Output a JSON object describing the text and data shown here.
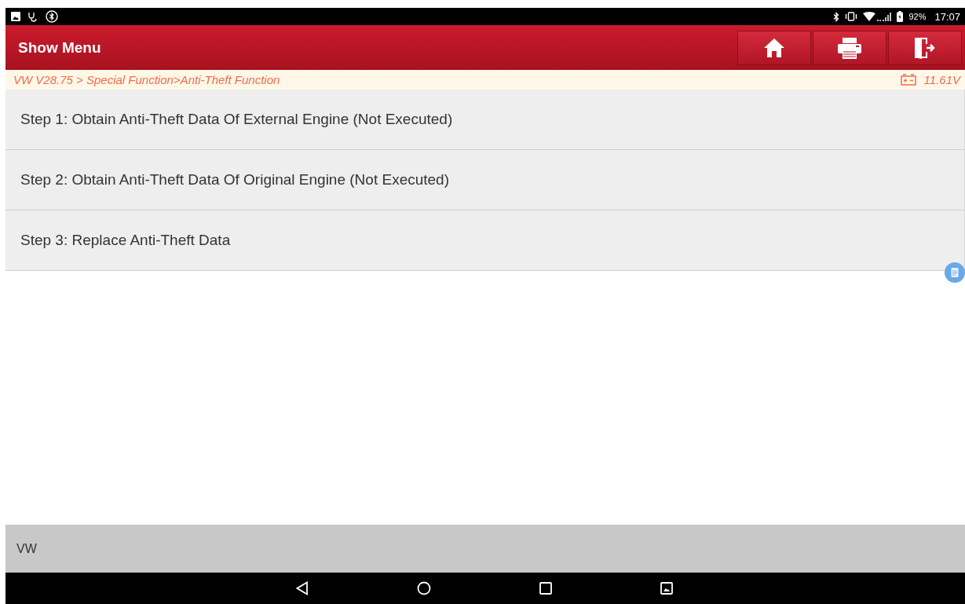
{
  "status_bar": {
    "battery": "92%",
    "time": "17:07"
  },
  "header": {
    "title": "Show Menu"
  },
  "breadcrumb": {
    "path": "VW V28.75 > Special Function>Anti-Theft Function",
    "voltage": "11.61V"
  },
  "menu_items": [
    {
      "label": "Step 1: Obtain Anti-Theft Data Of External Engine (Not Executed)"
    },
    {
      "label": "Step 2: Obtain Anti-Theft Data Of Original Engine (Not Executed)"
    },
    {
      "label": "Step 3: Replace Anti-Theft Data"
    }
  ],
  "footer": {
    "text": "VW"
  }
}
